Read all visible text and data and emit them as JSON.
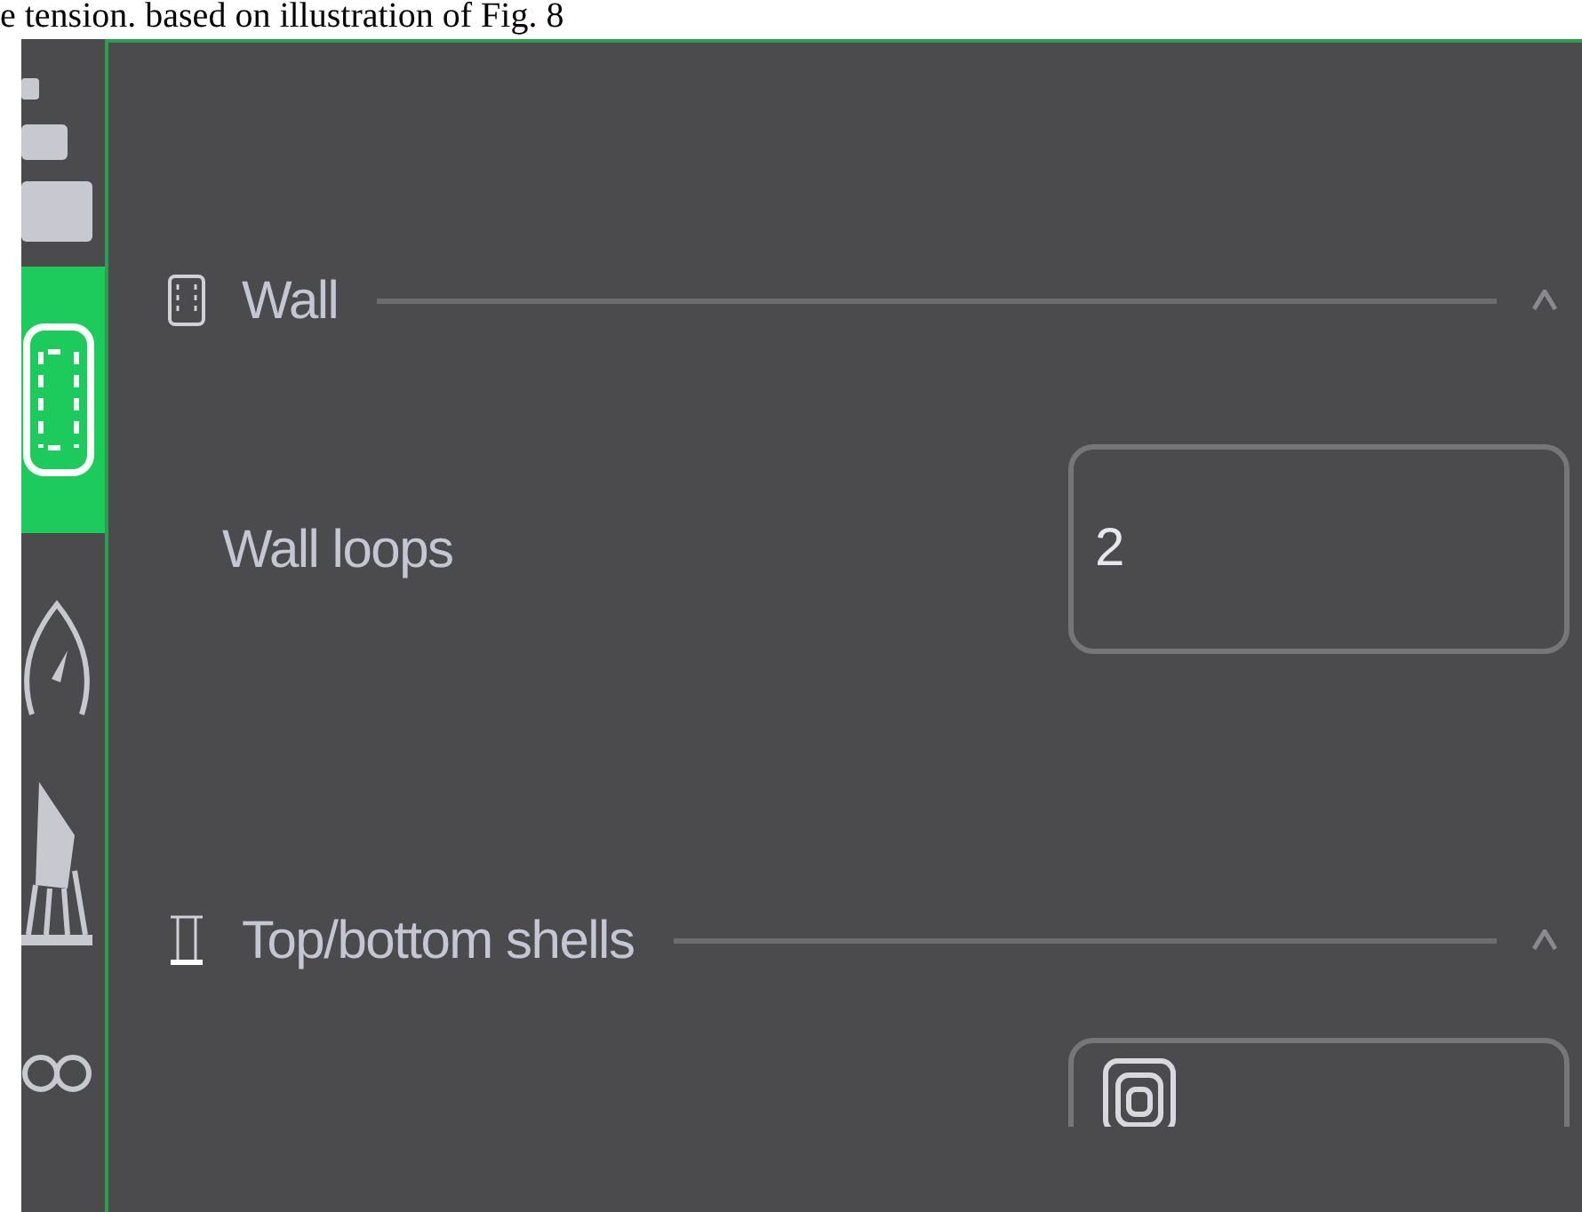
{
  "caption": "e tension. based on illustration of Fig. 8",
  "sidebar": {
    "items": [
      {
        "kind": "layers",
        "selected": false
      },
      {
        "kind": "wall",
        "selected": true
      },
      {
        "kind": "speed",
        "selected": false
      },
      {
        "kind": "support",
        "selected": false
      },
      {
        "kind": "other",
        "selected": false
      }
    ]
  },
  "sections": [
    {
      "kind": "wall",
      "title": "Wall",
      "expanded": true,
      "rows": [
        {
          "kind": "input",
          "label": "Wall loops",
          "value": "2"
        }
      ]
    },
    {
      "kind": "shells",
      "title": "Top/bottom shells",
      "expanded": true,
      "rows": [
        {
          "kind": "dropdown"
        }
      ]
    }
  ]
}
